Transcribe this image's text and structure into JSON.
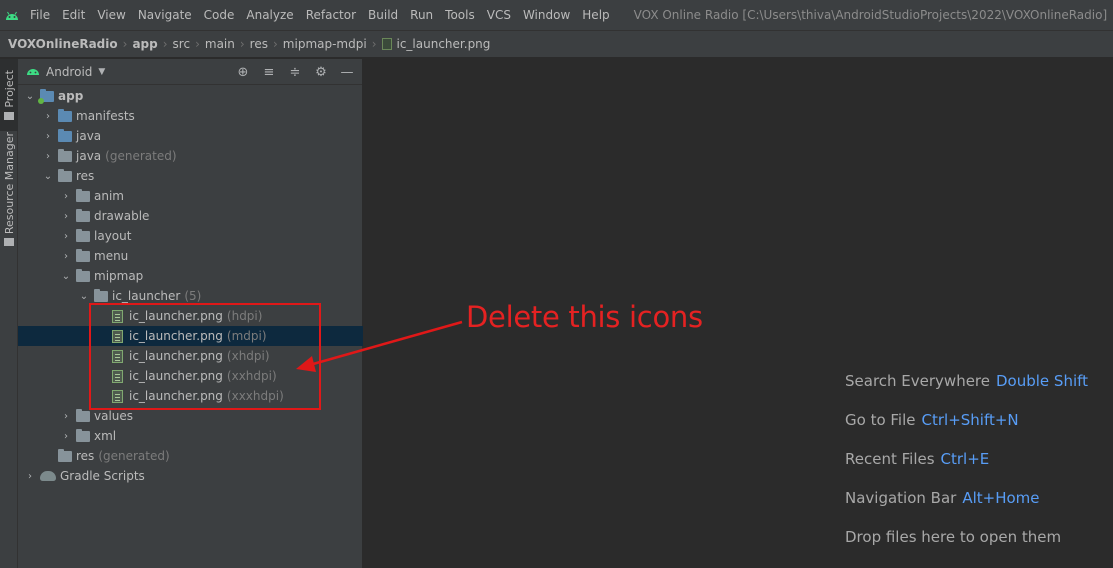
{
  "menu": {
    "items": [
      "File",
      "Edit",
      "View",
      "Navigate",
      "Code",
      "Analyze",
      "Refactor",
      "Build",
      "Run",
      "Tools",
      "VCS",
      "Window",
      "Help"
    ],
    "window_title": "VOX Online Radio [C:\\Users\\thiva\\AndroidStudioProjects\\2022\\VOXOnlineRadio]"
  },
  "breadcrumb": {
    "items": [
      "VOXOnlineRadio",
      "app",
      "src",
      "main",
      "res",
      "mipmap-mdpi",
      "ic_launcher.png"
    ]
  },
  "tool_stripe": {
    "project_label": "Project",
    "resource_manager_label": "Resource Manager"
  },
  "project_panel": {
    "view_selector": "Android",
    "tree": [
      {
        "label": "app",
        "suffix": "",
        "expanded": true
      },
      {
        "label": "manifests",
        "suffix": ""
      },
      {
        "label": "java",
        "suffix": ""
      },
      {
        "label": "java",
        "suffix": "(generated)"
      },
      {
        "label": "res",
        "suffix": "",
        "expanded": true
      },
      {
        "label": "anim",
        "suffix": ""
      },
      {
        "label": "drawable",
        "suffix": ""
      },
      {
        "label": "layout",
        "suffix": ""
      },
      {
        "label": "menu",
        "suffix": ""
      },
      {
        "label": "mipmap",
        "suffix": "",
        "expanded": true
      },
      {
        "label": "ic_launcher",
        "suffix": "(5)",
        "expanded": true
      },
      {
        "label": "ic_launcher.png",
        "suffix": "(hdpi)"
      },
      {
        "label": "ic_launcher.png",
        "suffix": "(mdpi)",
        "selected": true
      },
      {
        "label": "ic_launcher.png",
        "suffix": "(xhdpi)"
      },
      {
        "label": "ic_launcher.png",
        "suffix": "(xxhdpi)"
      },
      {
        "label": "ic_launcher.png",
        "suffix": "(xxxhdpi)"
      },
      {
        "label": "values",
        "suffix": ""
      },
      {
        "label": "xml",
        "suffix": ""
      },
      {
        "label": "res",
        "suffix": "(generated)"
      },
      {
        "label": "Gradle Scripts",
        "suffix": ""
      }
    ]
  },
  "annotation": {
    "text": "Delete this icons",
    "color": "#e52222"
  },
  "editor_hints": [
    {
      "label": "Search Everywhere",
      "key": "Double Shift"
    },
    {
      "label": "Go to File",
      "key": "Ctrl+Shift+N"
    },
    {
      "label": "Recent Files",
      "key": "Ctrl+E"
    },
    {
      "label": "Navigation Bar",
      "key": "Alt+Home"
    },
    {
      "label": "Drop files here to open them",
      "key": ""
    }
  ],
  "colors": {
    "accent_blue": "#589df6",
    "selection": "#0d293e",
    "android_green": "#62b543"
  }
}
